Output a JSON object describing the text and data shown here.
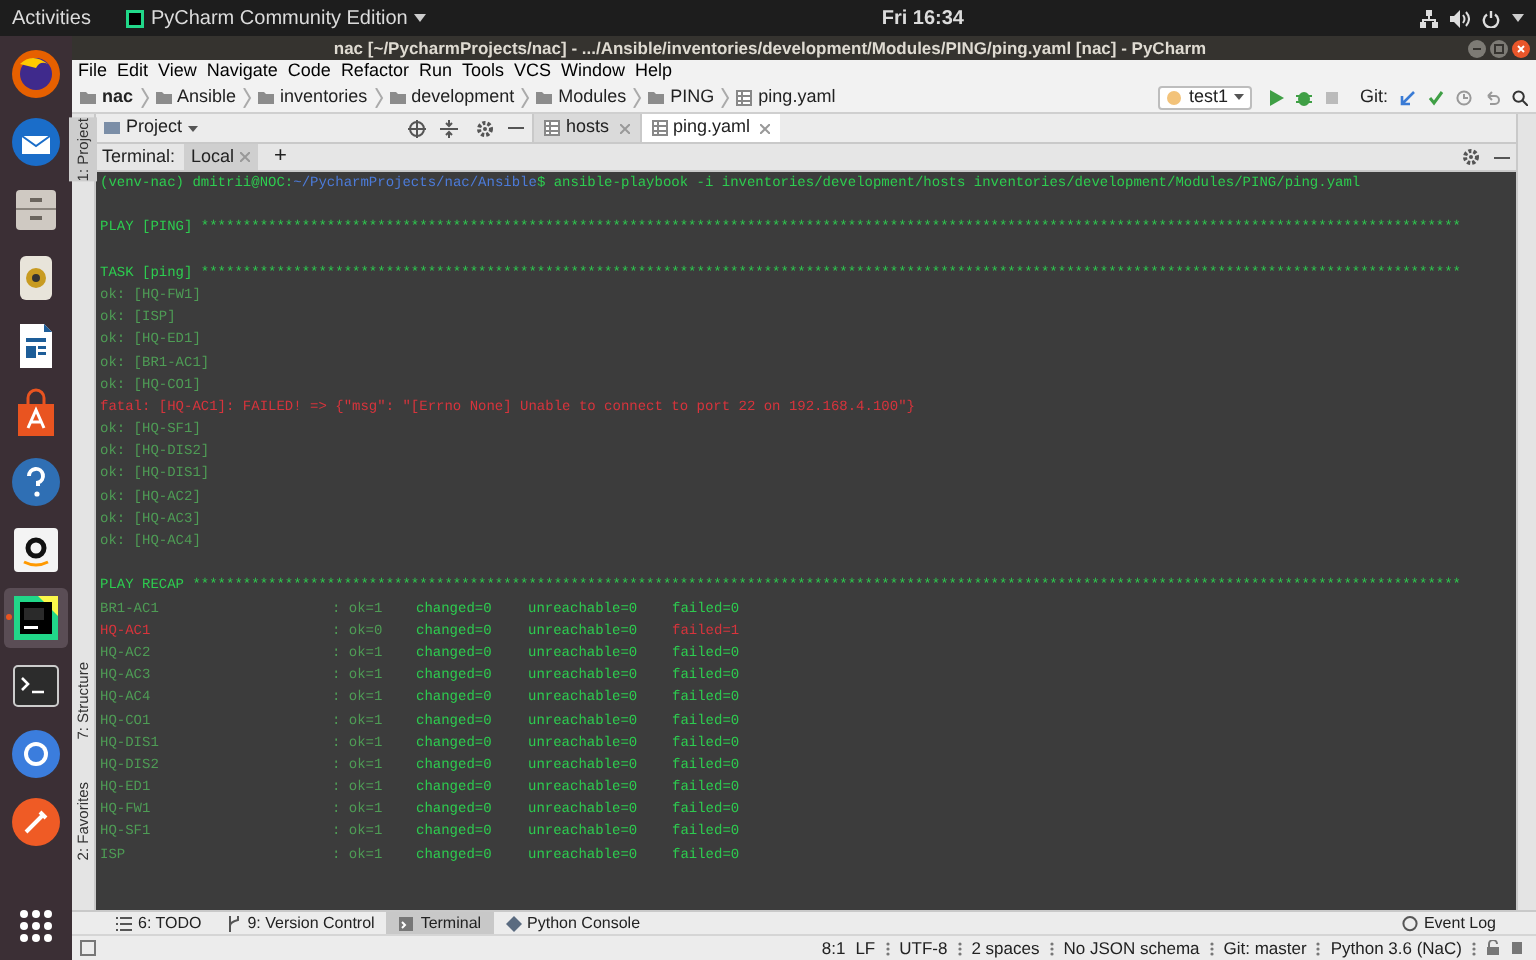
{
  "top_bar": {
    "activities": "Activities",
    "app_menu": "PyCharm Community Edition",
    "clock": "Fri 16:34"
  },
  "dock": {
    "items": [
      {
        "selected": false
      },
      {
        "selected": false
      },
      {
        "selected": false
      },
      {
        "selected": false
      },
      {
        "selected": false
      },
      {
        "selected": false
      },
      {
        "selected": false
      },
      {
        "selected": false
      },
      {
        "selected": true
      },
      {
        "selected": false
      },
      {
        "selected": false
      },
      {
        "selected": false
      }
    ]
  },
  "window": {
    "title": "nac [~/PycharmProjects/nac] - .../Ansible/inventories/development/Modules/PING/ping.yaml [nac] - PyCharm"
  },
  "menu": [
    "File",
    "Edit",
    "View",
    "Navigate",
    "Code",
    "Refactor",
    "Run",
    "Tools",
    "VCS",
    "Window",
    "Help"
  ],
  "breadcrumbs": [
    {
      "label": "nac",
      "kind": "folder"
    },
    {
      "label": "Ansible",
      "kind": "folder"
    },
    {
      "label": "inventories",
      "kind": "folder"
    },
    {
      "label": "development",
      "kind": "folder"
    },
    {
      "label": "Modules",
      "kind": "folder"
    },
    {
      "label": "PING",
      "kind": "folder"
    },
    {
      "label": "ping.yaml",
      "kind": "file"
    }
  ],
  "run_config": "test1",
  "git_label": "Git:",
  "project_panel": {
    "title": "Project"
  },
  "editor_tabs": [
    {
      "label": "hosts",
      "selected": false
    },
    {
      "label": "ping.yaml",
      "selected": true
    }
  ],
  "terminal": {
    "label": "Terminal:",
    "tabs": [
      {
        "label": "Local",
        "selected": true
      }
    ],
    "add": "+",
    "prompt": {
      "user": "(venv-nac) dmitrii@NOC:",
      "path": "~/PycharmProjects/nac/Ansible",
      "command": "$ ansible-playbook -i inventories/development/hosts inventories/development/Modules/PING/ping.yaml"
    },
    "lines": [
      {
        "kind": "blank"
      },
      {
        "kind": "header",
        "text": "PLAY [PING] ******************************************************************************************************************************************************"
      },
      {
        "kind": "blank"
      },
      {
        "kind": "header",
        "text": "TASK [ping] ******************************************************************************************************************************************************"
      },
      {
        "kind": "ok",
        "text": "ok: [HQ-FW1]"
      },
      {
        "kind": "ok",
        "text": "ok: [ISP]"
      },
      {
        "kind": "ok",
        "text": "ok: [HQ-ED1]"
      },
      {
        "kind": "ok",
        "text": "ok: [BR1-AC1]"
      },
      {
        "kind": "ok",
        "text": "ok: [HQ-CO1]"
      },
      {
        "kind": "fatal",
        "text": "fatal: [HQ-AC1]: FAILED! => {\"msg\": \"[Errno None] Unable to connect to port 22 on 192.168.4.100\"}"
      },
      {
        "kind": "ok",
        "text": "ok: [HQ-SF1]"
      },
      {
        "kind": "ok",
        "text": "ok: [HQ-DIS2]"
      },
      {
        "kind": "ok",
        "text": "ok: [HQ-DIS1]"
      },
      {
        "kind": "ok",
        "text": "ok: [HQ-AC2]"
      },
      {
        "kind": "ok",
        "text": "ok: [HQ-AC3]"
      },
      {
        "kind": "ok",
        "text": "ok: [HQ-AC4]"
      },
      {
        "kind": "blank"
      },
      {
        "kind": "header",
        "text": "PLAY RECAP *******************************************************************************************************************************************************"
      }
    ],
    "recap": [
      {
        "host": "BR1-AC1",
        "ok": ": ok=1",
        "changed": "changed=0",
        "unreachable": "unreachable=0",
        "failed_count": "failed=0",
        "failed": false
      },
      {
        "host": "HQ-AC1",
        "ok": ": ok=0",
        "changed": "changed=0",
        "unreachable": "unreachable=0",
        "failed_count": "failed=1",
        "failed": true
      },
      {
        "host": "HQ-AC2",
        "ok": ": ok=1",
        "changed": "changed=0",
        "unreachable": "unreachable=0",
        "failed_count": "failed=0",
        "failed": false
      },
      {
        "host": "HQ-AC3",
        "ok": ": ok=1",
        "changed": "changed=0",
        "unreachable": "unreachable=0",
        "failed_count": "failed=0",
        "failed": false
      },
      {
        "host": "HQ-AC4",
        "ok": ": ok=1",
        "changed": "changed=0",
        "unreachable": "unreachable=0",
        "failed_count": "failed=0",
        "failed": false
      },
      {
        "host": "HQ-CO1",
        "ok": ": ok=1",
        "changed": "changed=0",
        "unreachable": "unreachable=0",
        "failed_count": "failed=0",
        "failed": false
      },
      {
        "host": "HQ-DIS1",
        "ok": ": ok=1",
        "changed": "changed=0",
        "unreachable": "unreachable=0",
        "failed_count": "failed=0",
        "failed": false
      },
      {
        "host": "HQ-DIS2",
        "ok": ": ok=1",
        "changed": "changed=0",
        "unreachable": "unreachable=0",
        "failed_count": "failed=0",
        "failed": false
      },
      {
        "host": "HQ-ED1",
        "ok": ": ok=1",
        "changed": "changed=0",
        "unreachable": "unreachable=0",
        "failed_count": "failed=0",
        "failed": false
      },
      {
        "host": "HQ-FW1",
        "ok": ": ok=1",
        "changed": "changed=0",
        "unreachable": "unreachable=0",
        "failed_count": "failed=0",
        "failed": false
      },
      {
        "host": "HQ-SF1",
        "ok": ": ok=1",
        "changed": "changed=0",
        "unreachable": "unreachable=0",
        "failed_count": "failed=0",
        "failed": false
      },
      {
        "host": "ISP",
        "ok": ": ok=1",
        "changed": "changed=0",
        "unreachable": "unreachable=0",
        "failed_count": "failed=0",
        "failed": false
      }
    ]
  },
  "side_stripe": [
    "1: Project",
    "7: Structure",
    "2: Favorites"
  ],
  "bottom_tabs": [
    {
      "label": "6: TODO",
      "selected": false
    },
    {
      "label": "9: Version Control",
      "selected": false
    },
    {
      "label": "Terminal",
      "selected": true
    },
    {
      "label": "Python Console",
      "selected": false
    }
  ],
  "event_log": "Event Log",
  "status_bar": [
    "8:1",
    "LF",
    "UTF-8",
    "2 spaces",
    "No JSON schema",
    "Git: master",
    "Python 3.6 (NaC)"
  ]
}
